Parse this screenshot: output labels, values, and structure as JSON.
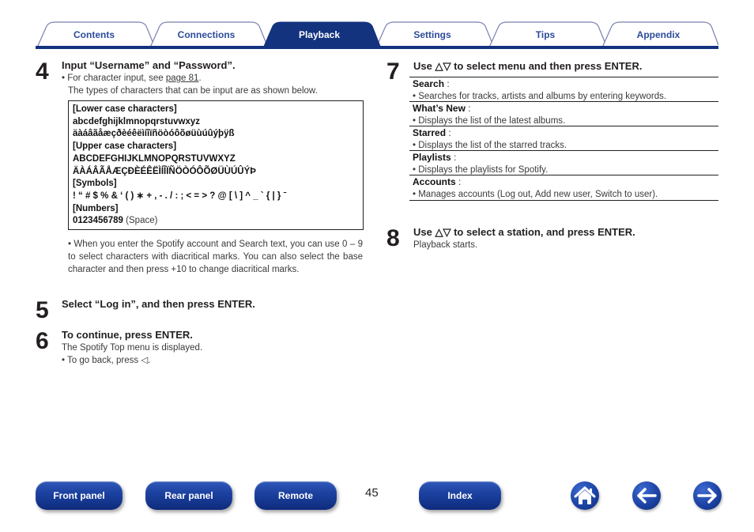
{
  "tabs": [
    {
      "label": "Contents",
      "active": false
    },
    {
      "label": "Connections",
      "active": false
    },
    {
      "label": "Playback",
      "active": true
    },
    {
      "label": "Settings",
      "active": false
    },
    {
      "label": "Tips",
      "active": false
    },
    {
      "label": "Appendix",
      "active": false
    }
  ],
  "colors": {
    "accent": "#13337f",
    "tab_text": "#2b4b9a",
    "button": "#1a3f9e"
  },
  "step4": {
    "number": "4",
    "title": "Input “Username” and “Password”.",
    "bullet_prefix": "• For character input, see ",
    "link": "page 81",
    "bullet_suffix": ".",
    "note": "The types of characters that can be input are as shown below.",
    "charbox": {
      "lower_heading": "[Lower case characters]",
      "lower_basic": "abcdefghijklmnopqrstuvwxyz",
      "lower_accented": "äàáâãåæçðèéêëìíîïñöòóôõøüùúûýþÿß",
      "upper_heading": "[Upper case characters]",
      "upper_basic": "ABCDEFGHIJKLMNOPQRSTUVWXYZ",
      "upper_accented": "ÄÀÁÂÃÅÆÇÐÈÉÊËÌÍÎÏÑÖÒÓÔÕØÜÙÚÛÝÞ",
      "symbols_heading": "[Symbols]",
      "symbols": "! “ # $ % & ‘ ( ) ∗ + , - . / : ; < = > ? @ [ \\ ] ^ _ ` { | } ˉ",
      "numbers_heading": "[Numbers]",
      "numbers": "0123456789",
      "space_label": "(Space)"
    },
    "paragraph": "• When you enter the Spotify account and Search text, you can use 0 – 9 to select characters with diacritical marks. You can also select the base character and then press +10 to change diacritical marks."
  },
  "step5": {
    "number": "5",
    "title": "Select “Log in”, and then press ENTER."
  },
  "step6": {
    "number": "6",
    "title": "To continue, press ENTER.",
    "line1": "The Spotify Top menu is displayed.",
    "line2": "• To go back, press ◁."
  },
  "step7": {
    "number": "7",
    "title": "Use △▽ to select menu and then press ENTER.",
    "menu": [
      {
        "name": "Search",
        "desc": "• Searches for tracks, artists and albums by entering keywords."
      },
      {
        "name": "What’s New",
        "desc": "• Displays the list of the latest albums."
      },
      {
        "name": "Starred",
        "desc": "• Displays the list of the starred tracks."
      },
      {
        "name": "Playlists",
        "desc": "• Displays the playlists for Spotify."
      },
      {
        "name": "Accounts",
        "desc": "• Manages accounts (Log out, Add new user, Switch to user)."
      }
    ],
    "colon": " :"
  },
  "step8": {
    "number": "8",
    "title": "Use △▽ to select a station, and press ENTER.",
    "line1": "Playback starts."
  },
  "footer": {
    "front_panel": "Front panel",
    "rear_panel": "Rear panel",
    "remote": "Remote",
    "page_number": "45",
    "index": "Index",
    "home_icon": "home-icon",
    "back_icon": "arrow-left-icon",
    "forward_icon": "arrow-right-icon"
  }
}
